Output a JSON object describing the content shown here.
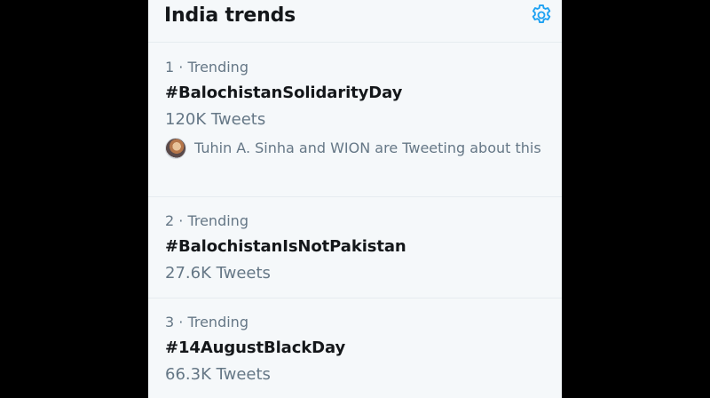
{
  "header": {
    "title": "India trends",
    "settings_icon": "gear-icon",
    "accent_color": "#1da1f2"
  },
  "trends": [
    {
      "meta": "1 · Trending",
      "name": "#BalochistanSolidarityDay",
      "count": "120K Tweets",
      "context": "Tuhin A. Sinha and WION are Tweeting about this"
    },
    {
      "meta": "2 · Trending",
      "name": "#BalochistanIsNotPakistan",
      "count": "27.6K Tweets"
    },
    {
      "meta": "3 · Trending",
      "name": "#14AugustBlackDay",
      "count": "66.3K Tweets"
    }
  ]
}
